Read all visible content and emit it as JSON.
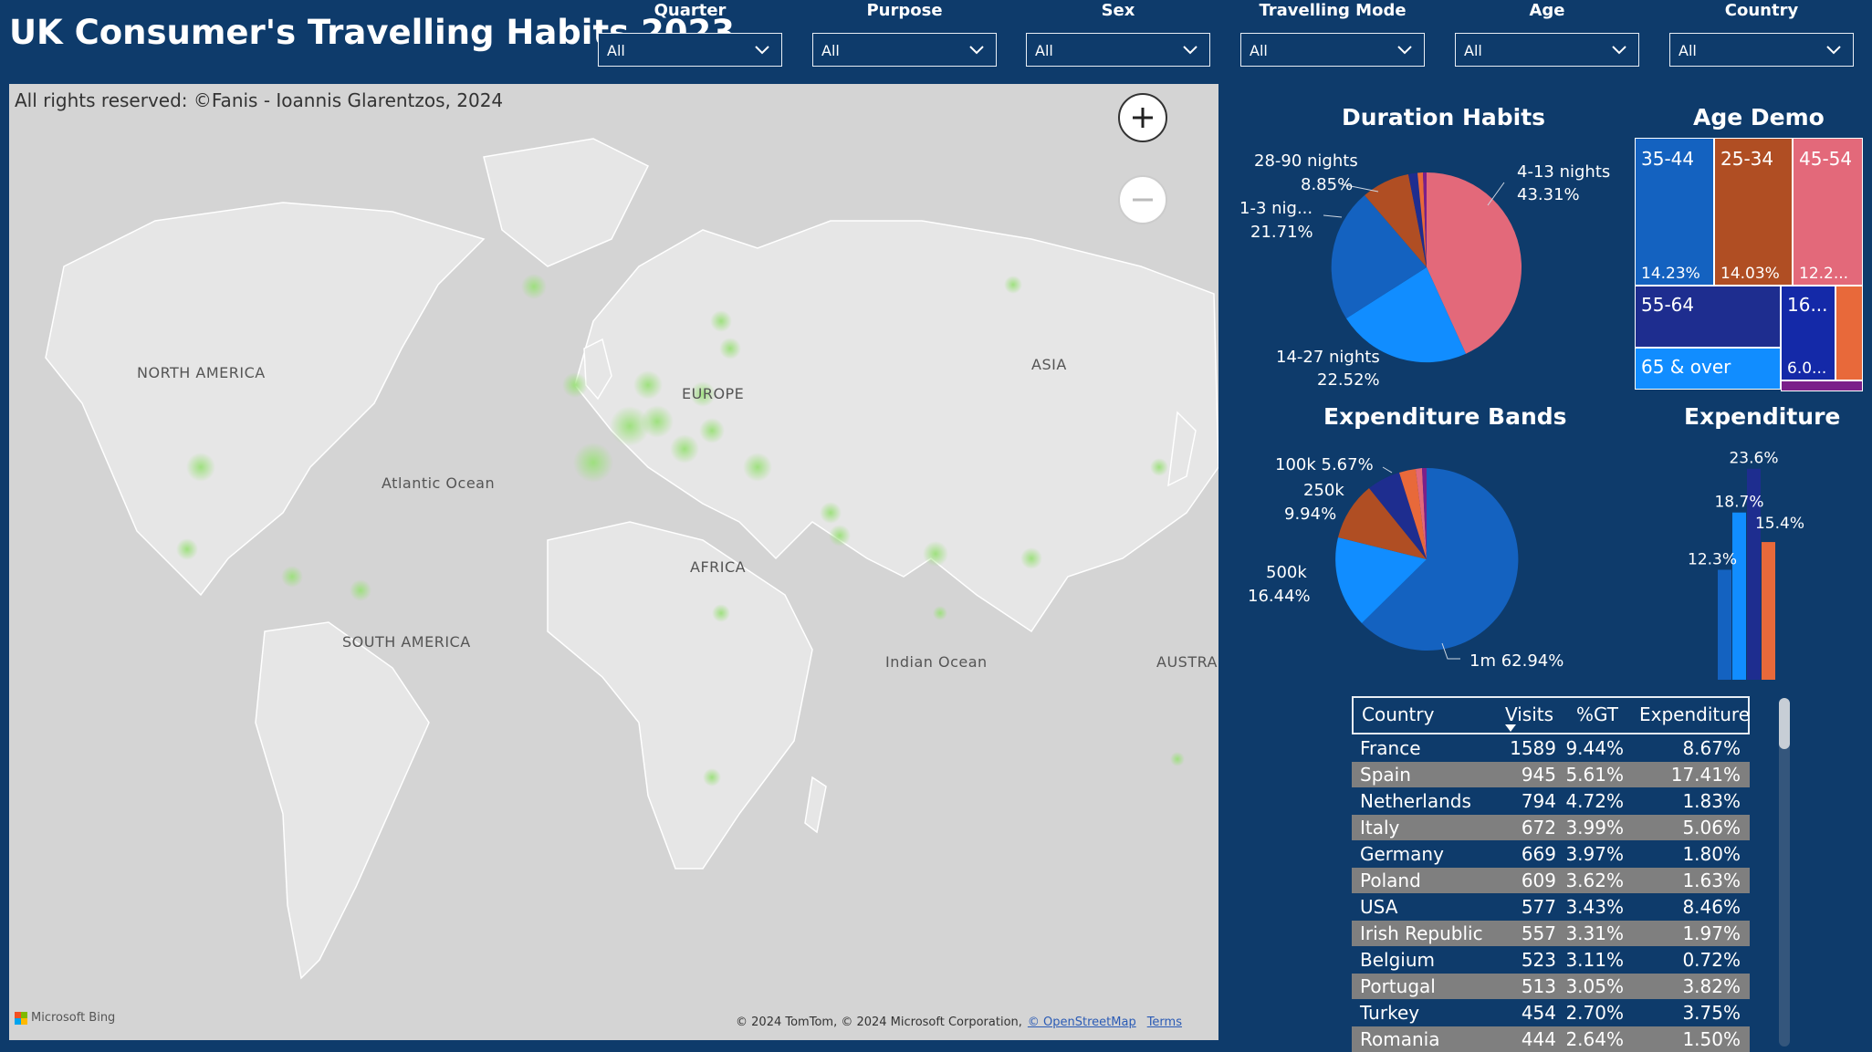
{
  "title": "UK Consumer's Travelling Habits 2023",
  "slicers": [
    {
      "label": "Quarter",
      "value": "All"
    },
    {
      "label": "Purpose",
      "value": "All"
    },
    {
      "label": "Sex",
      "value": "All"
    },
    {
      "label": "Travelling Mode",
      "value": "All"
    },
    {
      "label": "Age",
      "value": "All"
    },
    {
      "label": "Country",
      "value": "All"
    }
  ],
  "map": {
    "copyright": "All rights reserved: ©Fanis - Ioannis Glarentzos, 2024",
    "labels": {
      "north_america": "NORTH AMERICA",
      "europe": "EUROPE",
      "asia": "ASIA",
      "atlantic": "Atlantic Ocean",
      "africa": "AFRICA",
      "south_america": "SOUTH AMERICA",
      "indian": "Indian Ocean",
      "australia": "AUSTRAL"
    },
    "bing": "Microsoft Bing",
    "attribution": "© 2024 TomTom, © 2024 Microsoft Corporation,",
    "osm_link": "© OpenStreetMap",
    "terms_link": "Terms",
    "zoom_in_icon": "plus-icon",
    "zoom_out_icon": "minus-icon"
  },
  "duration": {
    "title": "Duration Habits",
    "colors": {
      "4-13 nights": "#e3697a",
      "14-27 nights": "#118dff",
      "1-3 nights": "#1462c0",
      "28-90 nights": "#b04e23",
      "other1": "#1e2d8f",
      "other2": "#e8693a",
      "other3": "#7b1f8a"
    },
    "labels": {
      "n413": "4-13 nights",
      "n413_pct": "43.31%",
      "n2890": "28-90 nights",
      "n2890_pct": "8.85%",
      "n13": "1-3 nig...",
      "n13_pct": "21.71%",
      "n1427": "14-27 nights",
      "n1427_pct": "22.52%"
    }
  },
  "age_demo": {
    "title": "Age Demo",
    "cells": {
      "c3544": "35-44",
      "c3544_v": "14.23%",
      "c2534": "25-34",
      "c2534_v": "14.03%",
      "c4554": "45-54",
      "c4554_v": "12.2...",
      "c5564": "55-64",
      "c16": "16...",
      "c16_v": "6.0...",
      "c65": "65 & over"
    }
  },
  "exp_bands": {
    "title": "Expenditure Bands",
    "labels": {
      "k100": "100k 5.67%",
      "k250": "250k",
      "k250_pct": "9.94%",
      "k500": "500k",
      "k500_pct": "16.44%",
      "m1": "1m 62.94%"
    }
  },
  "expenditure": {
    "title": "Expenditure",
    "bars": [
      {
        "label": "12.3%",
        "value": 12.3,
        "color": "#1462c0"
      },
      {
        "label": "18.7%",
        "value": 18.7,
        "color": "#118dff"
      },
      {
        "label": "23.6%",
        "value": 23.6,
        "color": "#1e2d8f"
      },
      {
        "label": "15.4%",
        "value": 15.4,
        "color": "#e8693a"
      }
    ]
  },
  "table": {
    "headers": [
      "Country",
      "Visits",
      "%GT",
      "Expenditure"
    ],
    "rows": [
      [
        "France",
        "1589",
        "9.44%",
        "8.67%"
      ],
      [
        "Spain",
        "945",
        "5.61%",
        "17.41%"
      ],
      [
        "Netherlands",
        "794",
        "4.72%",
        "1.83%"
      ],
      [
        "Italy",
        "672",
        "3.99%",
        "5.06%"
      ],
      [
        "Germany",
        "669",
        "3.97%",
        "1.80%"
      ],
      [
        "Poland",
        "609",
        "3.62%",
        "1.63%"
      ],
      [
        "USA",
        "577",
        "3.43%",
        "8.46%"
      ],
      [
        "Irish Republic",
        "557",
        "3.31%",
        "1.97%"
      ],
      [
        "Belgium",
        "523",
        "3.11%",
        "0.72%"
      ],
      [
        "Portugal",
        "513",
        "3.05%",
        "3.82%"
      ],
      [
        "Turkey",
        "454",
        "2.70%",
        "3.75%"
      ],
      [
        "Romania",
        "444",
        "2.64%",
        "1.50%"
      ]
    ]
  }
}
